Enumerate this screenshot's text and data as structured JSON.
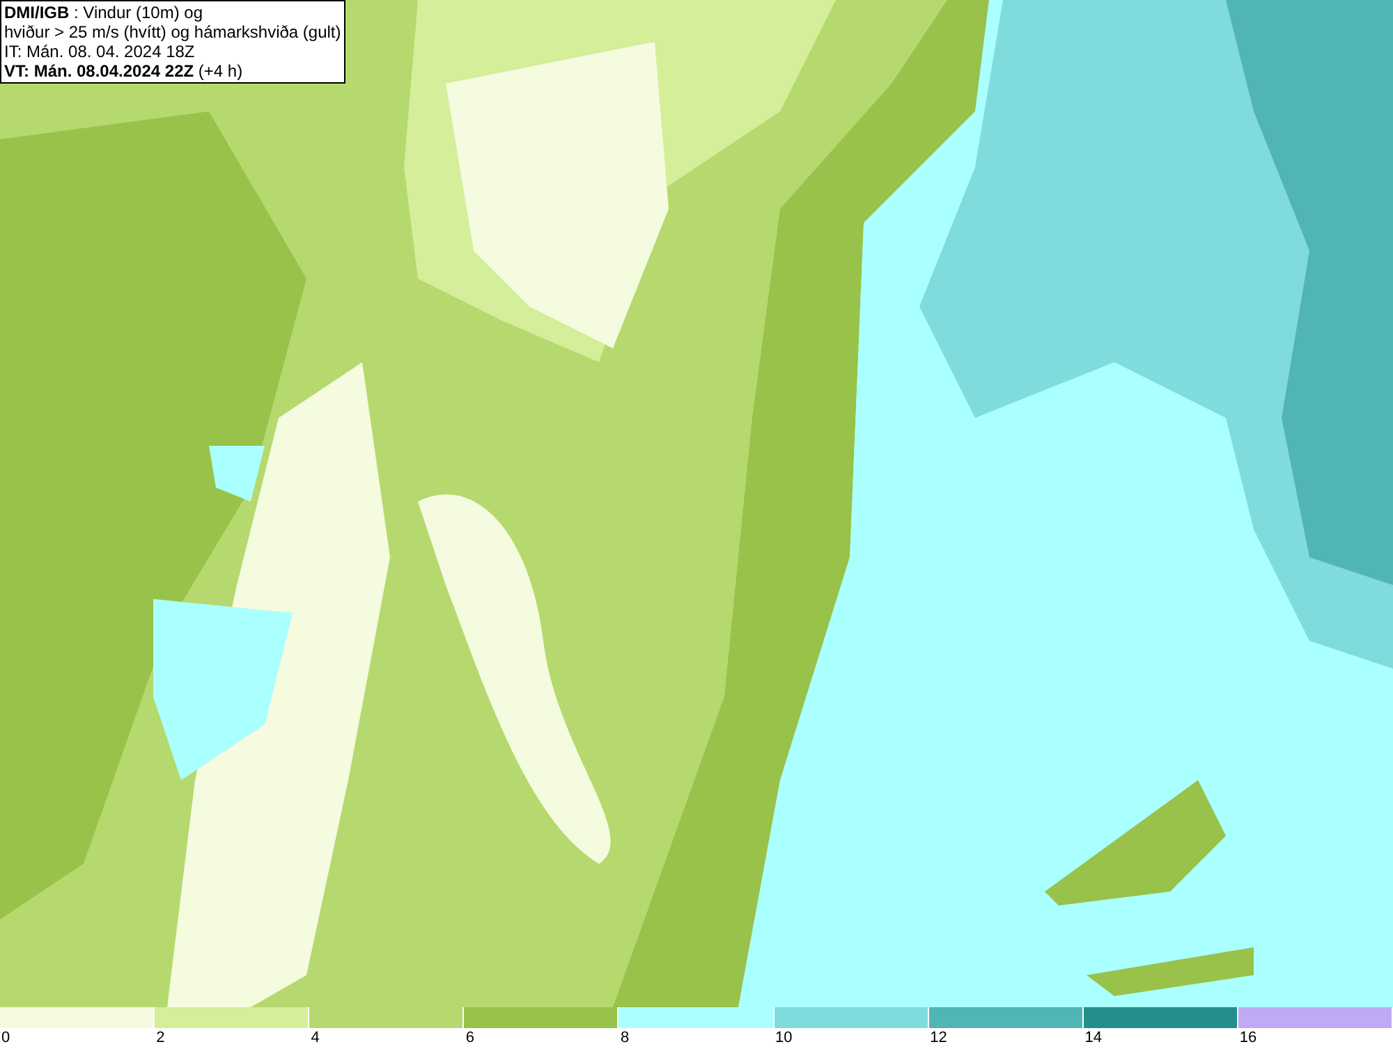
{
  "header": {
    "lines": [
      "**DMI/IGB** : Vindur (10m) og",
      "hviður > 25 m/s (hvítt) og hámarkshviða (gult)",
      "IT: Mán. 08. 04. 2024 18Z",
      "**VT: Mán. 08.04.2024 22Z** (+4 h)"
    ]
  },
  "legend": {
    "bins": [
      {
        "color": "#f4fbdf",
        "label": "0"
      },
      {
        "color": "#d4ee9a",
        "label": "2"
      },
      {
        "color": "#b5d96e",
        "label": "4"
      },
      {
        "color": "#98c24a",
        "label": "6"
      },
      {
        "color": "#aaffff",
        "label": "8"
      },
      {
        "color": "#80dcdc",
        "label": "10"
      },
      {
        "color": "#52b5b5",
        "label": "12"
      },
      {
        "color": "#228f8c",
        "label": "14"
      },
      {
        "color": "#c0aaf5",
        "label": "16"
      }
    ]
  }
}
